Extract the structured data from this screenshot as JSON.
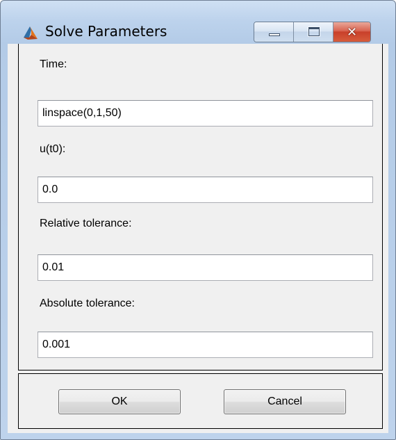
{
  "window": {
    "title": "Solve Parameters",
    "icon": "matlab-icon",
    "controls": [
      "minimize-icon",
      "maximize-icon",
      "close-icon"
    ],
    "close_glyph": "✕"
  },
  "form": {
    "time": {
      "label": "Time:",
      "value": "linspace(0,1,50)"
    },
    "u_t0": {
      "label": "u(t0):",
      "value": "0.0"
    },
    "relative_tolerance": {
      "label": "Relative tolerance:",
      "value": "0.01"
    },
    "absolute_tolerance": {
      "label": "Absolute tolerance:",
      "value": "0.001"
    }
  },
  "buttons": {
    "ok": "OK",
    "cancel": "Cancel"
  },
  "colors": {
    "titlebar": "#bcd2ec",
    "dialog_bg": "#f0f0f0",
    "close_button": "#c8402a"
  }
}
